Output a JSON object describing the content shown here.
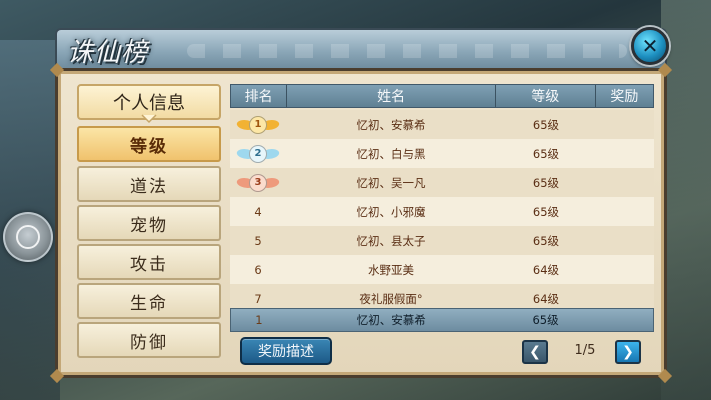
{
  "window": {
    "title": "诛仙榜"
  },
  "sidebar": {
    "header_label": "个人信息",
    "items": [
      {
        "label": "等级",
        "active": true
      },
      {
        "label": "道法",
        "active": false
      },
      {
        "label": "宠物",
        "active": false
      },
      {
        "label": "攻击",
        "active": false
      },
      {
        "label": "生命",
        "active": false
      },
      {
        "label": "防御",
        "active": false
      }
    ]
  },
  "table": {
    "headers": [
      "排名",
      "姓名",
      "等级",
      "奖励"
    ],
    "rows": [
      {
        "rank": "1",
        "name": "忆初、安慕希",
        "level": "65级",
        "medal": "gold"
      },
      {
        "rank": "2",
        "name": "忆初、白与黑",
        "level": "65级",
        "medal": "silver"
      },
      {
        "rank": "3",
        "name": "忆初、吴一凡",
        "level": "65级",
        "medal": "bronze"
      },
      {
        "rank": "4",
        "name": "忆初、小邪魔",
        "level": "65级",
        "medal": ""
      },
      {
        "rank": "5",
        "name": "忆初、县太子",
        "level": "65级",
        "medal": ""
      },
      {
        "rank": "6",
        "name": "水野亚美",
        "level": "64级",
        "medal": ""
      },
      {
        "rank": "7",
        "name": "夜礼服假面°",
        "level": "64级",
        "medal": ""
      }
    ],
    "own_row": {
      "rank": "1",
      "name": "忆初、安慕希",
      "level": "65级"
    }
  },
  "footer": {
    "reward_desc_label": "奖励描述",
    "page_indicator": "1/5"
  },
  "colors": {
    "gold": "#f2b233",
    "silver": "#9ed8ee",
    "bronze": "#ee9a7c"
  },
  "icons": {
    "close": "close-icon",
    "prev": "chevron-left-icon",
    "next": "chevron-right-icon"
  }
}
